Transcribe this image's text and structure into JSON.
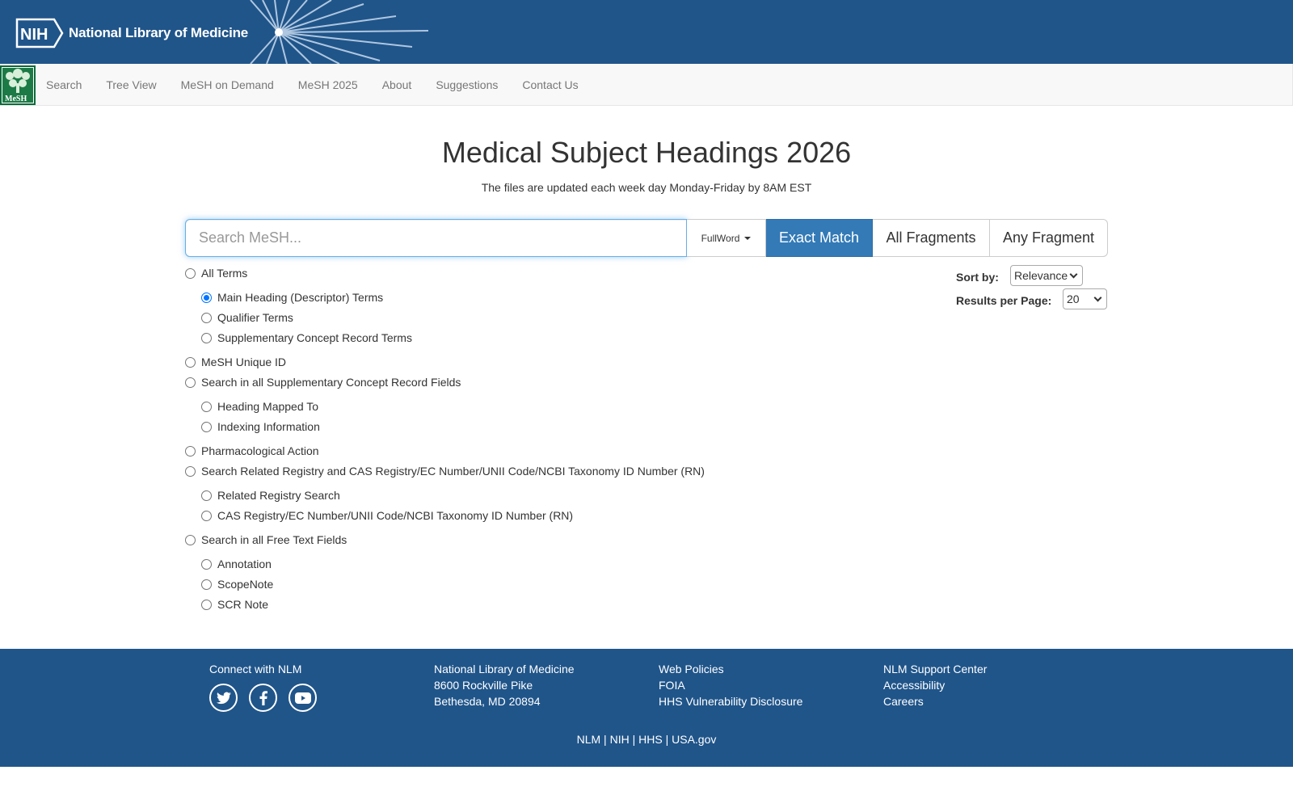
{
  "header": {
    "org_name": "National Library of Medicine",
    "nih_abbr": "NIH"
  },
  "nav": {
    "items": [
      "Search",
      "Tree View",
      "MeSH on Demand",
      "MeSH 2025",
      "About",
      "Suggestions",
      "Contact Us"
    ]
  },
  "page": {
    "title": "Medical Subject Headings 2026",
    "subtitle": "The files are updated each week day Monday-Friday by 8AM EST"
  },
  "search": {
    "placeholder": "Search MeSH...",
    "value": "",
    "mode": "FullWord",
    "buttons": {
      "exact": "Exact Match",
      "fragments": "All Fragments",
      "any": "Any Fragment"
    },
    "active_button": "Exact Match"
  },
  "options": {
    "all_terms": "All Terms",
    "main_heading": "Main Heading (Descriptor) Terms",
    "qualifier": "Qualifier Terms",
    "scr_terms": "Supplementary Concept Record Terms",
    "unique_id": "MeSH Unique ID",
    "scr_fields": "Search in all Supplementary Concept Record Fields",
    "heading_mapped": "Heading Mapped To",
    "indexing_info": "Indexing Information",
    "pharm_action": "Pharmacological Action",
    "related_registry_all": "Search Related Registry and CAS Registry/EC Number/UNII Code/NCBI Taxonomy ID Number (RN)",
    "related_registry": "Related Registry Search",
    "cas_registry": "CAS Registry/EC Number/UNII Code/NCBI Taxonomy ID Number (RN)",
    "free_text": "Search in all Free Text Fields",
    "annotation": "Annotation",
    "scope_note": "ScopeNote",
    "scr_note": "SCR Note",
    "selected": "Main Heading (Descriptor) Terms"
  },
  "sort": {
    "sort_label": "Sort by:",
    "sort_value": "Relevance",
    "rpp_label": "Results per Page:",
    "rpp_value": "20"
  },
  "footer": {
    "connect": "Connect with NLM",
    "address": [
      "National Library of Medicine",
      "8600 Rockville Pike",
      "Bethesda, MD 20894"
    ],
    "policies": [
      "Web Policies",
      "FOIA",
      "HHS Vulnerability Disclosure"
    ],
    "support": [
      "NLM Support Center",
      "Accessibility",
      "Careers"
    ],
    "bottom": [
      "NLM",
      "NIH",
      "HHS",
      "USA.gov"
    ],
    "social_icons": [
      "twitter-icon",
      "facebook-icon",
      "youtube-icon"
    ]
  },
  "colors": {
    "banner": "#20558a",
    "accent": "#337ab7"
  }
}
